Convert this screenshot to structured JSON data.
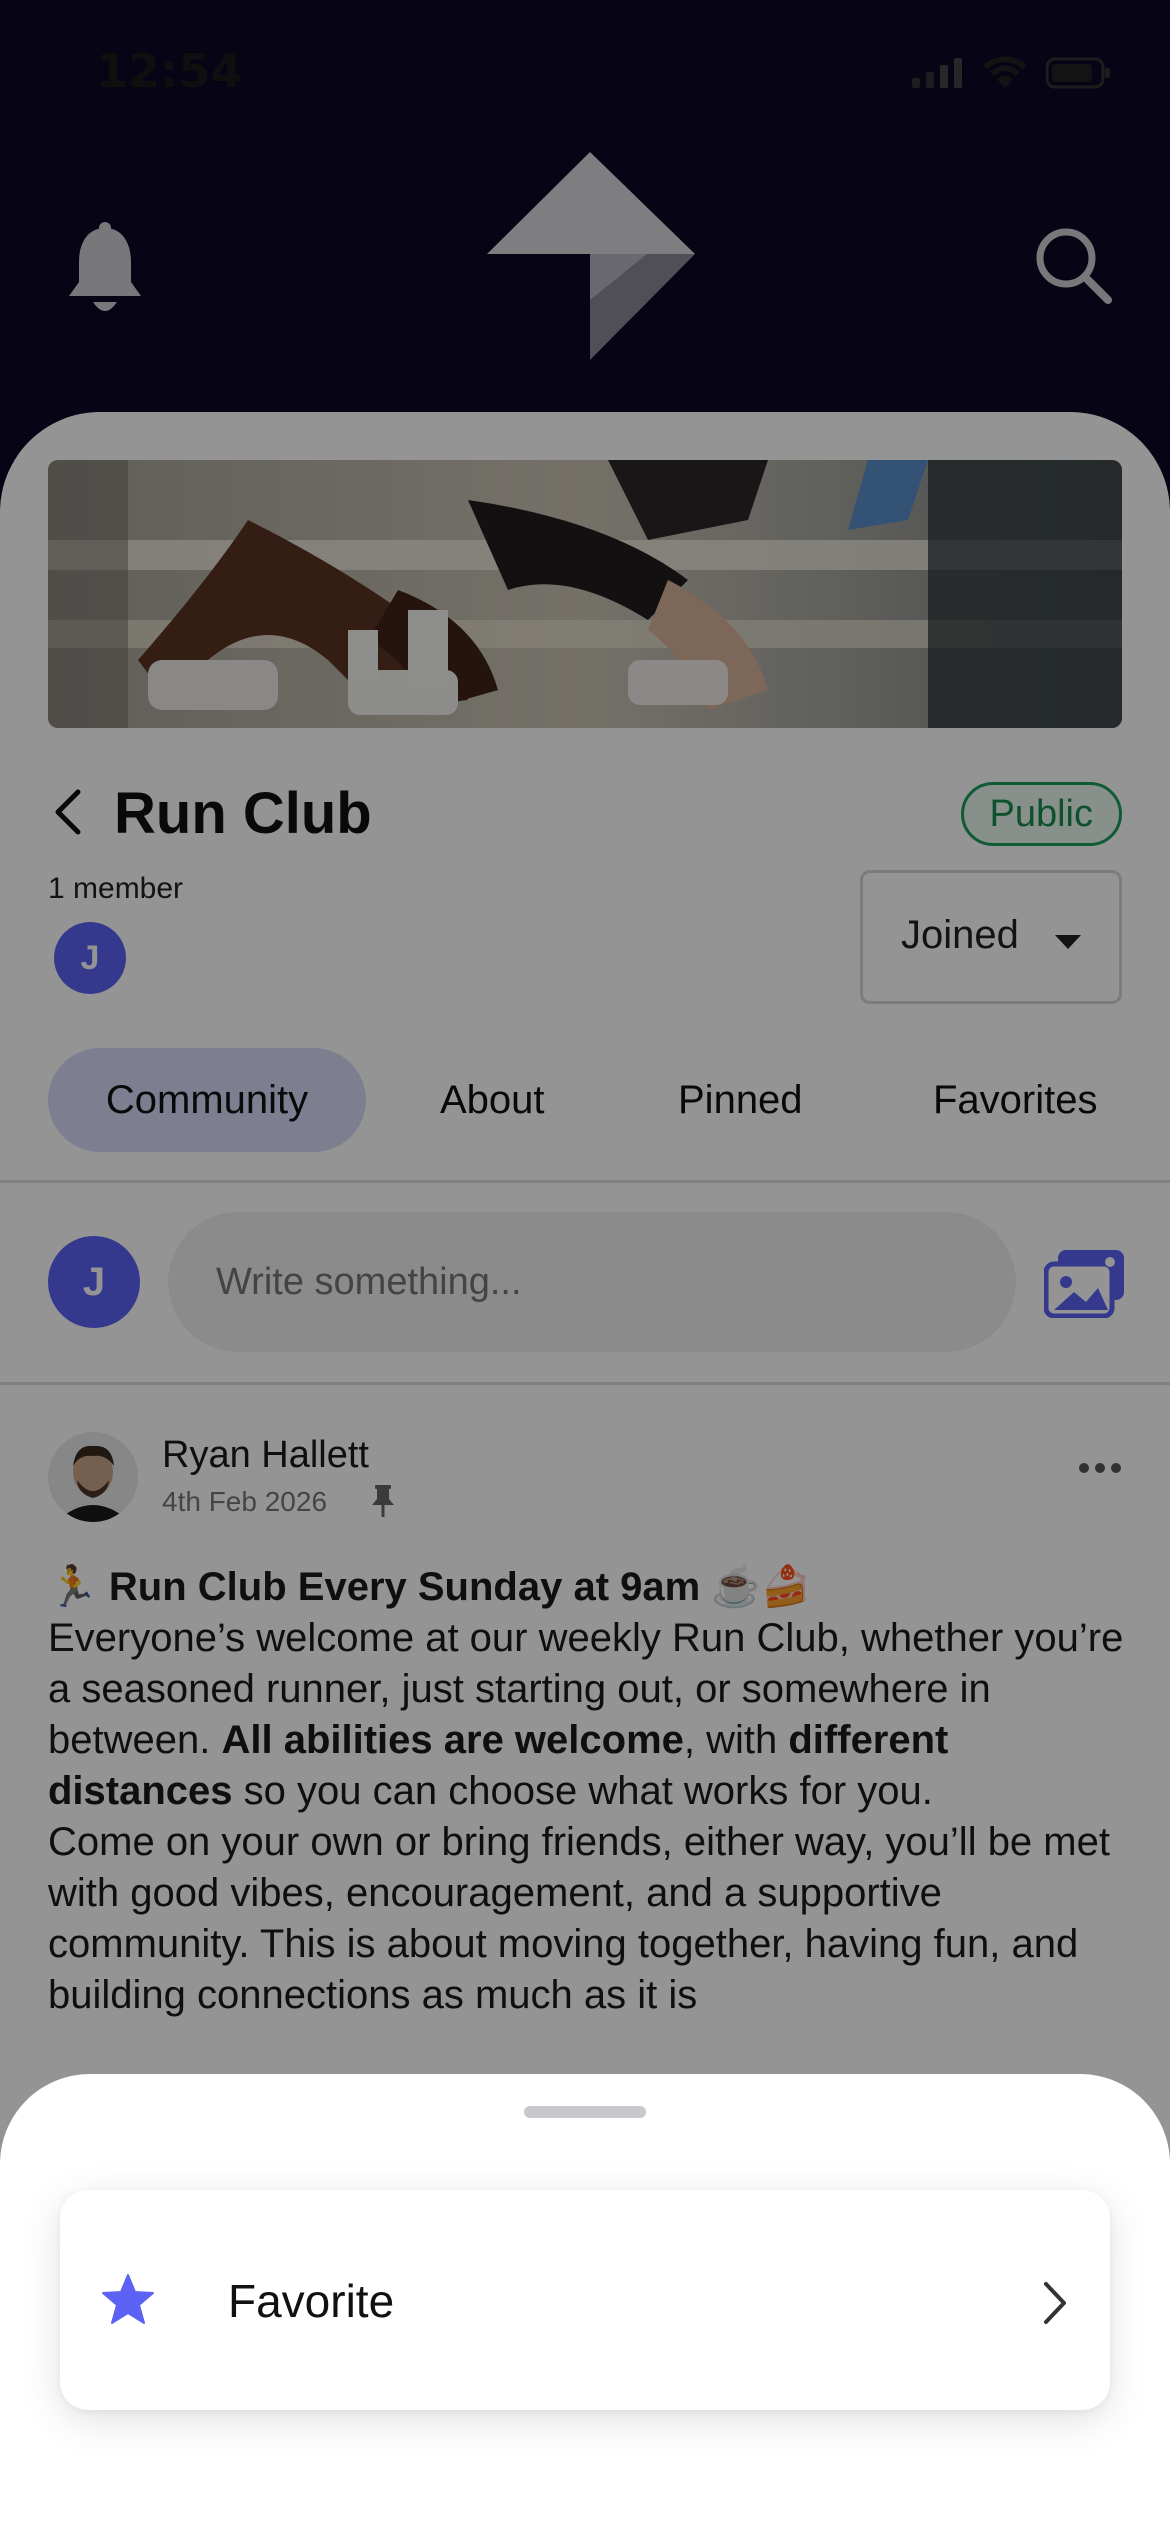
{
  "status_bar": {
    "time": "12:54"
  },
  "header": {
    "notifications_icon": "bell-icon",
    "logo": "brand-logo",
    "search_icon": "search-icon"
  },
  "group": {
    "title": "Run Club",
    "privacy_badge": "Public",
    "member_count": "1 member",
    "member_initial": "J",
    "joined_label": "Joined"
  },
  "tabs": [
    {
      "label": "Community",
      "active": true
    },
    {
      "label": "About",
      "active": false
    },
    {
      "label": "Pinned",
      "active": false
    },
    {
      "label": "Favorites",
      "active": false
    }
  ],
  "composer": {
    "avatar_initial": "J",
    "placeholder": "Write something..."
  },
  "post": {
    "author": "Ryan Hallett",
    "date": "4th Feb 2026",
    "title": "🏃 Run Club Every Sunday at 9am ☕🍰",
    "body_1_pre": "Everyone’s welcome at our weekly Run Club, whether you’re a seasoned runner, just starting out, or somewhere in between. ",
    "body_1_bold_a": "All abilities are welcome",
    "body_1_mid": ", with ",
    "body_1_bold_b": "different distances",
    "body_1_post": " so you can choose what works for you.",
    "body_2": "Come on your own or bring friends, either way, you’ll be met with good vibes, encouragement, and a supportive community. This is about moving together, having fun, and building connections as much as it is"
  },
  "bottom_sheet": {
    "option_label": "Favorite",
    "option_icon": "star-icon"
  },
  "colors": {
    "header_bg": "#0d0826",
    "accent": "#5c62f4",
    "public_green": "#1a8a4f"
  }
}
